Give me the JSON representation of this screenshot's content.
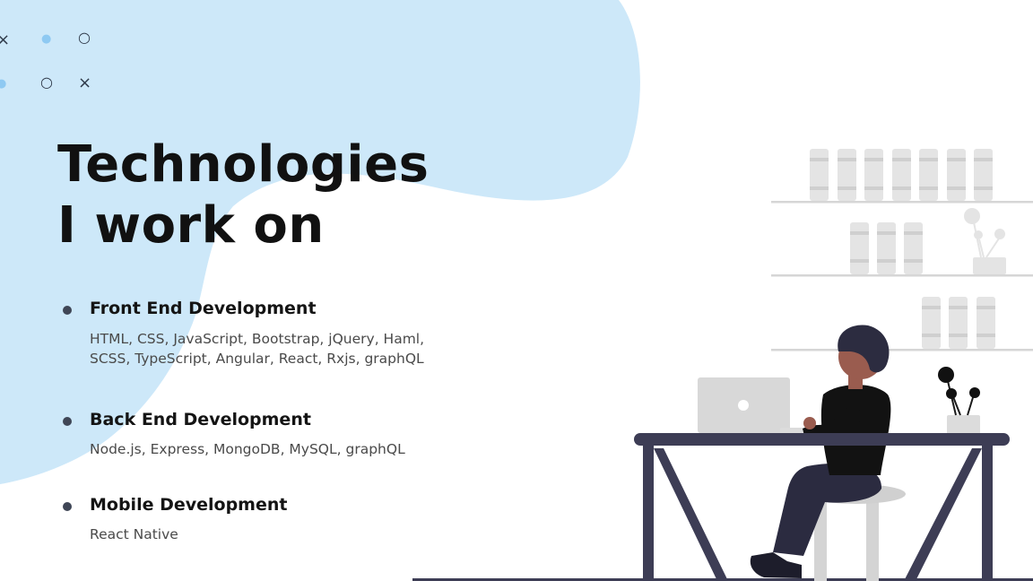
{
  "colors": {
    "blob": "#cde8f9",
    "heading": "#111111",
    "body_text": "#4a4a4a",
    "bullet": "#3f4656",
    "desk": "#3d3d55",
    "shelf_items": "#e3e3e3",
    "laptop": "#d8d8d8"
  },
  "decorations": {
    "row1": [
      "×",
      "●",
      "○"
    ],
    "row2": [
      "●",
      "○",
      "×"
    ]
  },
  "heading": {
    "line1": "Technologies",
    "line2": "I work on"
  },
  "sections": [
    {
      "title": "Front End Development",
      "lines": [
        "HTML, CSS, JavaScript, Bootstrap, jQuery, Haml,",
        "SCSS, TypeScript, Angular, React, Rxjs, graphQL"
      ]
    },
    {
      "title": "Back End Development",
      "lines": [
        "Node.js, Express, MongoDB, MySQL, graphQL"
      ]
    },
    {
      "title": "Mobile Development",
      "lines": [
        "React Native"
      ]
    }
  ],
  "illustration": {
    "subject": "person-working-on-laptop"
  }
}
